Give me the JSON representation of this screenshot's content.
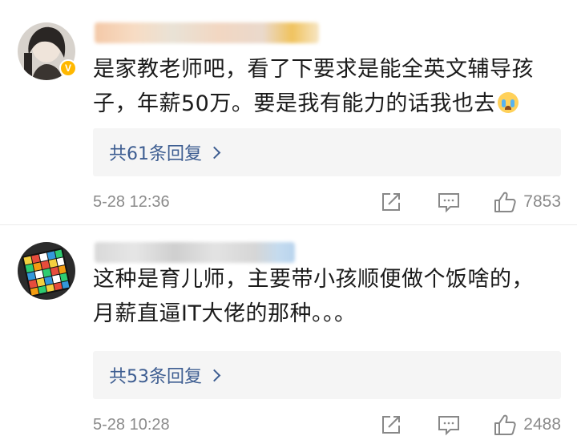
{
  "comments": [
    {
      "username": "",
      "verified": true,
      "text_line1": "是家教老师吧，看了下要求是能全英文辅导孩",
      "text_line2": "子，年薪50万。要是我有能力的话我也去",
      "emoji": "crying-face",
      "replies_label": "共61条回复",
      "timestamp": "5-28 12:36",
      "likes": "7853"
    },
    {
      "username": "",
      "verified": false,
      "text_line1": "这种是育儿师，主要带小孩顺便做个饭啥的，",
      "text_line2": "月薪直逼IT大佬的那种。。。",
      "replies_label": "共53条回复",
      "timestamp": "5-28 10:28",
      "likes": "2488"
    }
  ],
  "colors": {
    "reply_link": "#3d5d91",
    "meta_text": "#8a8a8a",
    "verified_badge": "#ffb800",
    "reply_box_bg": "#f5f5f5"
  },
  "icons": {
    "share": "share-icon",
    "comment": "comment-icon",
    "like": "thumbs-up-icon",
    "chevron": "chevron-right-icon"
  }
}
